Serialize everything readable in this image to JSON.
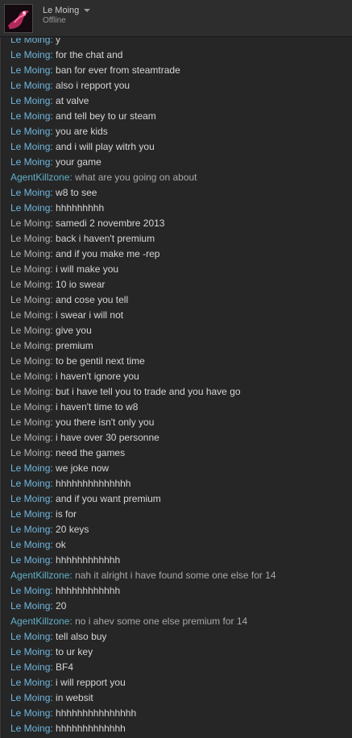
{
  "profile": {
    "name": "Le Moing",
    "status": "Offline"
  },
  "colors": {
    "self": "#6fb6dd",
    "self_alt": "#b0b0b0",
    "other": "#62b0c8",
    "text": "#d6d6d6",
    "background": "#262626"
  },
  "messages": [
    {
      "sender": "Le Moing",
      "text": "y",
      "kind": "self"
    },
    {
      "sender": "Le Moing",
      "text": "for the chat and",
      "kind": "self"
    },
    {
      "sender": "Le Moing",
      "text": "ban for ever from steamtrade",
      "kind": "self"
    },
    {
      "sender": "Le Moing",
      "text": "also i repport you",
      "kind": "self"
    },
    {
      "sender": "Le Moing",
      "text": "at valve",
      "kind": "self"
    },
    {
      "sender": "Le Moing",
      "text": "and tell bey to ur steam",
      "kind": "self"
    },
    {
      "sender": "Le Moing",
      "text": "you are kids",
      "kind": "self"
    },
    {
      "sender": "Le Moing",
      "text": "and i will play witrh you",
      "kind": "self"
    },
    {
      "sender": "Le Moing",
      "text": "your game",
      "kind": "self"
    },
    {
      "sender": "AgentKillzone",
      "text": "what are you going on about",
      "kind": "other"
    },
    {
      "sender": "Le Moing",
      "text": "w8 to see",
      "kind": "self"
    },
    {
      "sender": "Le Moing",
      "text": "hhhhhhhhh",
      "kind": "self"
    },
    {
      "sender": "Le Moing",
      "text": "samedi 2 novembre 2013",
      "kind": "grey"
    },
    {
      "sender": "Le Moing",
      "text": "back i haven't premium",
      "kind": "grey"
    },
    {
      "sender": "Le Moing",
      "text": "and if you make me -rep",
      "kind": "grey"
    },
    {
      "sender": "Le Moing",
      "text": "i will make you",
      "kind": "grey"
    },
    {
      "sender": "Le Moing",
      "text": "10 io swear",
      "kind": "grey"
    },
    {
      "sender": "Le Moing",
      "text": "and cose you tell",
      "kind": "grey"
    },
    {
      "sender": "Le Moing",
      "text": "i swear i will not",
      "kind": "grey"
    },
    {
      "sender": "Le Moing",
      "text": "give you",
      "kind": "grey"
    },
    {
      "sender": "Le Moing",
      "text": "premium",
      "kind": "grey"
    },
    {
      "sender": "Le Moing",
      "text": "to be gentil next time",
      "kind": "grey"
    },
    {
      "sender": "Le Moing",
      "text": "i haven't ignore you",
      "kind": "grey"
    },
    {
      "sender": "Le Moing",
      "text": "but i have tell you to trade and you have go",
      "kind": "grey"
    },
    {
      "sender": "Le Moing",
      "text": "i haven't time to w8",
      "kind": "grey"
    },
    {
      "sender": "Le Moing",
      "text": "you there isn't only you",
      "kind": "grey"
    },
    {
      "sender": "Le Moing",
      "text": "i have over 30 personne",
      "kind": "grey"
    },
    {
      "sender": "Le Moing",
      "text": "need the games",
      "kind": "grey"
    },
    {
      "sender": "Le Moing",
      "text": "we joke now",
      "kind": "self"
    },
    {
      "sender": "Le Moing",
      "text": "hhhhhhhhhhhhhh",
      "kind": "self"
    },
    {
      "sender": "Le Moing",
      "text": "and if you want premium",
      "kind": "self"
    },
    {
      "sender": "Le Moing",
      "text": "is for",
      "kind": "self"
    },
    {
      "sender": "Le Moing",
      "text": "20 keys",
      "kind": "self"
    },
    {
      "sender": "Le Moing",
      "text": "ok",
      "kind": "self"
    },
    {
      "sender": "Le Moing",
      "text": "hhhhhhhhhhhh",
      "kind": "self"
    },
    {
      "sender": "AgentKillzone",
      "text": "nah it alright i have found some one else for 14",
      "kind": "other"
    },
    {
      "sender": "Le Moing",
      "text": "hhhhhhhhhhhh",
      "kind": "self"
    },
    {
      "sender": "Le Moing",
      "text": "20",
      "kind": "self"
    },
    {
      "sender": "AgentKillzone",
      "text": "no i ahev some one else premium for 14",
      "kind": "other"
    },
    {
      "sender": "Le Moing",
      "text": "tell also buy",
      "kind": "self"
    },
    {
      "sender": "Le Moing",
      "text": "to ur key",
      "kind": "self"
    },
    {
      "sender": "Le Moing",
      "text": "BF4",
      "kind": "self"
    },
    {
      "sender": "Le Moing",
      "text": "i will repport you",
      "kind": "self"
    },
    {
      "sender": "Le Moing",
      "text": "in websit",
      "kind": "self"
    },
    {
      "sender": "Le Moing",
      "text": "hhhhhhhhhhhhhhh",
      "kind": "self"
    },
    {
      "sender": "Le Moing",
      "text": "hhhhhhhhhhhhh",
      "kind": "self"
    }
  ]
}
